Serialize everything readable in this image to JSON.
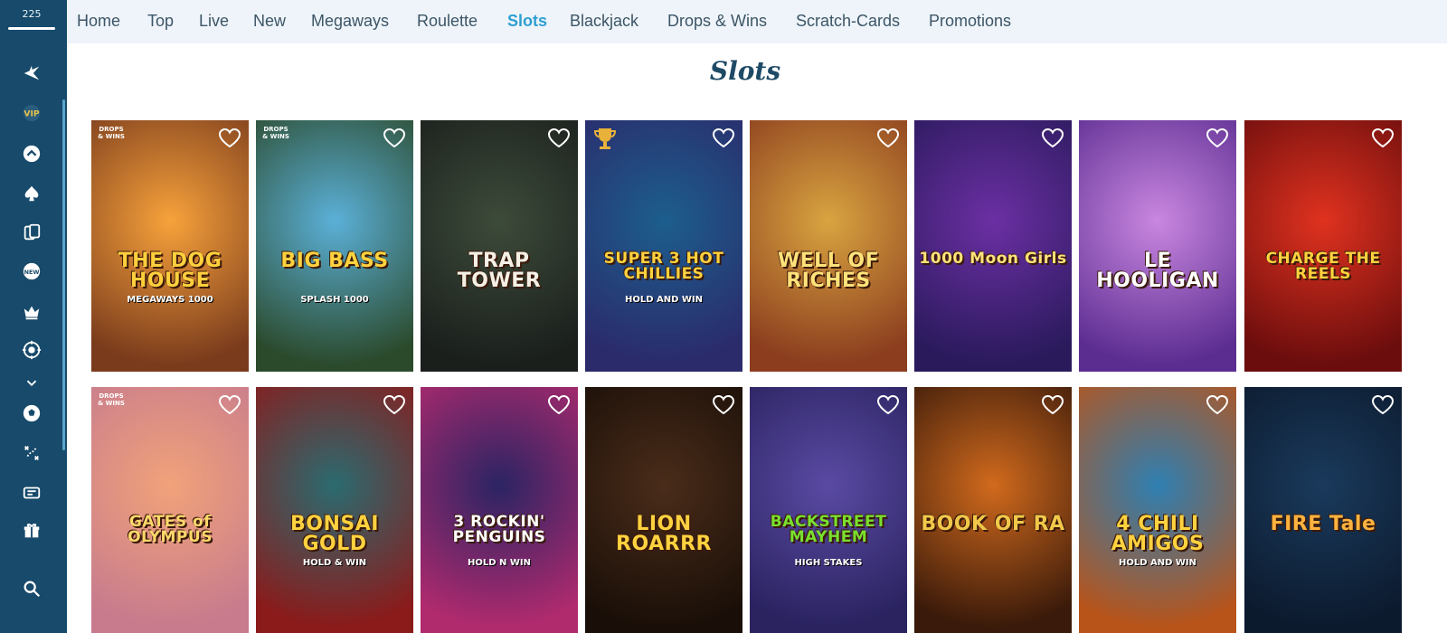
{
  "sidebar": {
    "balance": "225",
    "icons": [
      "star-plane-icon",
      "vip-icon",
      "chevron-up-circle-icon",
      "spade-icon",
      "cards-icon",
      "new-badge-icon",
      "crown-icon",
      "roulette-icon",
      "chevron-down-icon",
      "soccer-ball-icon",
      "tactics-icon",
      "ticket-icon",
      "gift-icon",
      "search-icon"
    ]
  },
  "nav": {
    "items": [
      "Home",
      "Top",
      "Live",
      "New",
      "Megaways",
      "Roulette",
      "Slots",
      "Blackjack",
      "Drops & Wins",
      "Scratch-Cards",
      "Promotions"
    ],
    "active": "Slots"
  },
  "page": {
    "title": "Slots"
  },
  "games": [
    {
      "title": "THE DOG HOUSE",
      "subtitle": "MEGAWAYS 1000",
      "badge": "DROPS & WINS",
      "theme": [
        "#f7a23b",
        "#7a3b1c"
      ],
      "text_color": "#ffcf3d"
    },
    {
      "title": "BIG BASS",
      "subtitle": "SPLASH 1000",
      "badge": "DROPS & WINS",
      "theme": [
        "#5bb0d8",
        "#2b4a2c"
      ],
      "text_color": "#ffd23f"
    },
    {
      "title": "TRAP TOWER",
      "subtitle": "",
      "badge": "",
      "theme": [
        "#3d4b3a",
        "#1a1f1c"
      ],
      "text_color": "#f5f0e6"
    },
    {
      "title": "SUPER 3 HOT CHILLIES",
      "subtitle": "HOLD AND WIN",
      "badge": "trophy",
      "theme": [
        "#1c5e8d",
        "#2b2a6b"
      ],
      "text_color": "#ffd23f"
    },
    {
      "title": "WELL OF RICHES",
      "subtitle": "",
      "badge": "",
      "theme": [
        "#d9a440",
        "#8b3d1e"
      ],
      "text_color": "#ffe27a"
    },
    {
      "title": "1000 Moon Girls",
      "subtitle": "",
      "badge": "",
      "theme": [
        "#6b2fa3",
        "#2a1a5c"
      ],
      "text_color": "#ffe27a"
    },
    {
      "title": "LE HOOLIGAN",
      "subtitle": "",
      "badge": "",
      "theme": [
        "#c987e0",
        "#5c2d91"
      ],
      "text_color": "#ffffff"
    },
    {
      "title": "CHARGE THE REELS",
      "subtitle": "",
      "badge": "",
      "theme": [
        "#e0321f",
        "#6b0d0d"
      ],
      "text_color": "#ffd23f"
    },
    {
      "title": "GATES of OLYMPUS",
      "subtitle": "",
      "badge": "DROPS & WINS",
      "theme": [
        "#f1a27a",
        "#c77b8d"
      ],
      "text_color": "#ffd86b"
    },
    {
      "title": "BONSAI GOLD",
      "subtitle": "HOLD & WIN",
      "badge": "",
      "theme": [
        "#2a6b70",
        "#8b1a1a"
      ],
      "text_color": "#ffd23f"
    },
    {
      "title": "3 ROCKIN' PENGUINS",
      "subtitle": "HOLD N WIN",
      "badge": "",
      "theme": [
        "#2b2463",
        "#b02a6e"
      ],
      "text_color": "#ffffff"
    },
    {
      "title": "LION ROARRR",
      "subtitle": "",
      "badge": "",
      "theme": [
        "#4a2c1a",
        "#1a0f08"
      ],
      "text_color": "#ffd23f"
    },
    {
      "title": "BACKSTREET MAYHEM",
      "subtitle": "HIGH STAKES",
      "badge": "",
      "theme": [
        "#5a4aa3",
        "#2a2360"
      ],
      "text_color": "#7ae02f"
    },
    {
      "title": "BOOK OF RA",
      "subtitle": "",
      "badge": "",
      "theme": [
        "#d16a1d",
        "#3a1a0a"
      ],
      "text_color": "#f2c84a"
    },
    {
      "title": "4 CHILI AMIGOS",
      "subtitle": "HOLD AND WIN",
      "badge": "",
      "theme": [
        "#2e7fb2",
        "#b8541a"
      ],
      "text_color": "#ffd23f"
    },
    {
      "title": "FIRE Tale",
      "subtitle": "",
      "badge": "",
      "theme": [
        "#1a3a5c",
        "#0c1a2e"
      ],
      "text_color": "#ffb23f"
    }
  ]
}
